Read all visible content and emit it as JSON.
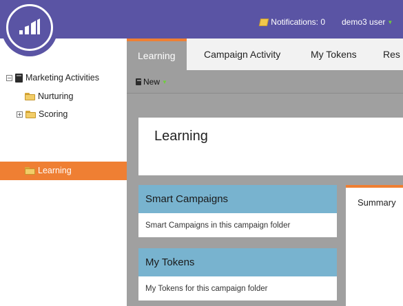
{
  "header": {
    "notifications_label": "Notifications: 0",
    "user_label": "demo3 user"
  },
  "sidebar": {
    "root": "Marketing Activities",
    "items": [
      {
        "label": "Nurturing"
      },
      {
        "label": "Scoring"
      },
      {
        "label": "Learning",
        "selected": true
      }
    ]
  },
  "tabs": [
    "Learning",
    "Campaign Activity",
    "My Tokens",
    "Res"
  ],
  "toolbar": {
    "new_label": "New"
  },
  "main": {
    "title": "Learning",
    "cards": [
      {
        "title": "Smart Campaigns",
        "description": "Smart Campaigns in this campaign folder"
      },
      {
        "title": "My Tokens",
        "description": "My Tokens for this campaign folder"
      }
    ],
    "summary_label": "Summary"
  },
  "colors": {
    "brand_purple": "#5a54a4",
    "accent_orange": "#ef7f33",
    "card_header_blue": "#78b3cf",
    "panel_gray": "#9e9e9e"
  }
}
